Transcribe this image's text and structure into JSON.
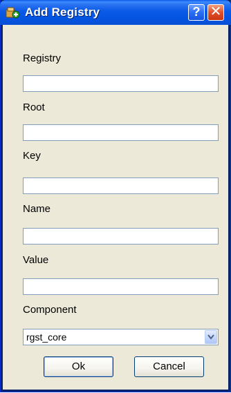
{
  "window": {
    "title": "Add Registry",
    "help_label": "?",
    "close_label": "✕",
    "icon": "registry-add-icon"
  },
  "form": {
    "registry_label": "Registry",
    "registry_value": "",
    "root_label": "Root",
    "root_value": "",
    "key_label": "Key",
    "key_value": "",
    "name_label": "Name",
    "name_value": "",
    "value_label": "Value",
    "value_value": "",
    "component_label": "Component",
    "component_value": "rgst_core"
  },
  "buttons": {
    "ok_label": "Ok",
    "cancel_label": "Cancel"
  },
  "colors": {
    "titlebar": "#0a5ae8",
    "client_bg": "#ece9d8",
    "input_border": "#7f9db9",
    "close_red": "#e0502a"
  }
}
